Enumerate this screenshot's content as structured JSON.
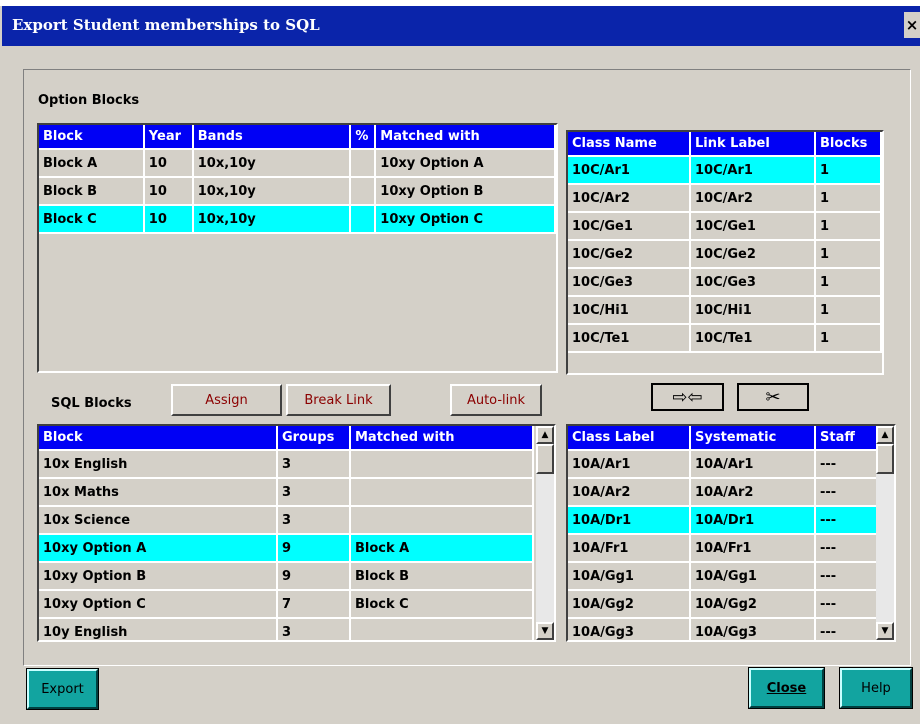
{
  "window": {
    "title": "Export Student memberships to SQL",
    "close_glyph": "×"
  },
  "option_blocks": {
    "label": "Option Blocks",
    "columns": [
      "Block",
      "Year",
      "Bands",
      "%",
      "Matched with"
    ],
    "rows": [
      {
        "block": "Block A",
        "year": "10",
        "bands": "10x,10y",
        "pct": "",
        "matched": "10xy Option A",
        "selected": false
      },
      {
        "block": "Block B",
        "year": "10",
        "bands": "10x,10y",
        "pct": "",
        "matched": "10xy Option B",
        "selected": false
      },
      {
        "block": "Block C",
        "year": "10",
        "bands": "10x,10y",
        "pct": "",
        "matched": "10xy Option C",
        "selected": true
      }
    ]
  },
  "class_table": {
    "columns": [
      "Class Name",
      "Link Label",
      "Blocks"
    ],
    "rows": [
      {
        "name": "10C/Ar1",
        "link": "10C/Ar1",
        "blocks": "1",
        "selected": true
      },
      {
        "name": "10C/Ar2",
        "link": "10C/Ar2",
        "blocks": "1",
        "selected": false
      },
      {
        "name": "10C/Ge1",
        "link": "10C/Ge1",
        "blocks": "1",
        "selected": false
      },
      {
        "name": "10C/Ge2",
        "link": "10C/Ge2",
        "blocks": "1",
        "selected": false
      },
      {
        "name": "10C/Ge3",
        "link": "10C/Ge3",
        "blocks": "1",
        "selected": false
      },
      {
        "name": "10C/Hi1",
        "link": "10C/Hi1",
        "blocks": "1",
        "selected": false
      },
      {
        "name": "10C/Te1",
        "link": "10C/Te1",
        "blocks": "1",
        "selected": false
      }
    ]
  },
  "sql_blocks": {
    "label": "SQL Blocks",
    "assign_label": "Assign",
    "break_link_label": "Break Link",
    "auto_link_label": "Auto-link",
    "columns": [
      "Block",
      "Groups",
      "Matched with"
    ],
    "rows": [
      {
        "block": "10x English",
        "groups": "3",
        "matched": "",
        "selected": false
      },
      {
        "block": "10x Maths",
        "groups": "3",
        "matched": "",
        "selected": false
      },
      {
        "block": "10x Science",
        "groups": "3",
        "matched": "",
        "selected": false
      },
      {
        "block": "10xy Option A",
        "groups": "9",
        "matched": "Block A",
        "selected": true
      },
      {
        "block": "10xy Option B",
        "groups": "9",
        "matched": "Block B",
        "selected": false
      },
      {
        "block": "10xy Option C",
        "groups": "7",
        "matched": "Block C",
        "selected": false
      },
      {
        "block": "10y English",
        "groups": "3",
        "matched": "",
        "selected": false
      }
    ]
  },
  "link_tools": {
    "link_icon": "arrows-together-icon",
    "link_glyph": "⇨⇦",
    "cut_icon": "scissors-icon",
    "cut_glyph": "✂"
  },
  "class_label_table": {
    "columns": [
      "Class Label",
      "Systematic",
      "Staff"
    ],
    "rows": [
      {
        "label": "10A/Ar1",
        "sys": "10A/Ar1",
        "staff": "---",
        "selected": false
      },
      {
        "label": "10A/Ar2",
        "sys": "10A/Ar2",
        "staff": "---",
        "selected": false
      },
      {
        "label": "10A/Dr1",
        "sys": "10A/Dr1",
        "staff": "---",
        "selected": true
      },
      {
        "label": "10A/Fr1",
        "sys": "10A/Fr1",
        "staff": "---",
        "selected": false
      },
      {
        "label": "10A/Gg1",
        "sys": "10A/Gg1",
        "staff": "---",
        "selected": false
      },
      {
        "label": "10A/Gg2",
        "sys": "10A/Gg2",
        "staff": "---",
        "selected": false
      },
      {
        "label": "10A/Gg3",
        "sys": "10A/Gg3",
        "staff": "---",
        "selected": false
      }
    ]
  },
  "footer": {
    "export_label": "Export",
    "close_label": "Close",
    "help_label": "Help"
  },
  "colors": {
    "header_bg": "#0000f5",
    "selection": "#00ffff",
    "title_bar": "#0a24aa",
    "teal_button": "#12a4a0"
  }
}
